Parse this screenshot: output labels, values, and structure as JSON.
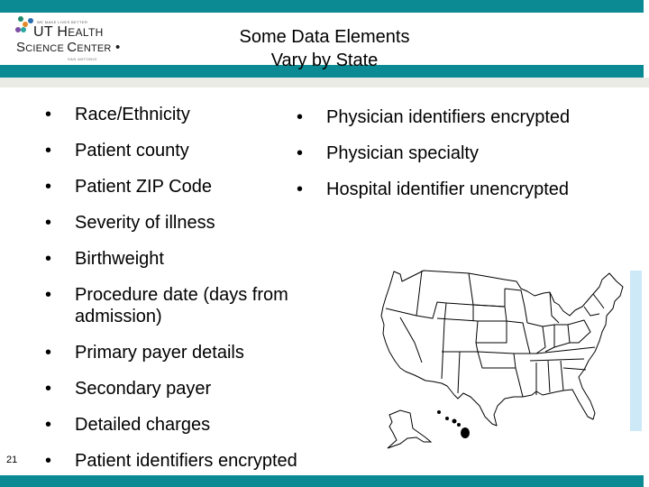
{
  "slide": {
    "title_line1": "Some Data Elements",
    "title_line2": "Vary by State",
    "slide_number": "21"
  },
  "logo": {
    "tagline": "WE MAKE LIVES BETTER",
    "line1_U": "UT H",
    "line1_rest": "EALTH",
    "line2_S": "S",
    "line2_rest1": "CIENCE ",
    "line2_C": "C",
    "line2_rest2": "ENTER",
    "line2_dot": " •",
    "sub": "SAN ANTONIO",
    "dot_colors": [
      "#1f8a6e",
      "#e38b2c",
      "#2a6fb0",
      "#7b4ea3",
      "#2aa7a0"
    ]
  },
  "colors": {
    "band": "#0b8a94",
    "gray_strip": "#ebebe6",
    "side_strip": "#cde9f8"
  },
  "left_bullets": [
    {
      "bullet": "•",
      "text": "Race/Ethnicity"
    },
    {
      "bullet": "•",
      "text": "Patient county"
    },
    {
      "bullet": "•",
      "text": "Patient ZIP Code"
    },
    {
      "bullet": "•",
      "text": "Severity of illness"
    },
    {
      "bullet": "•",
      "text": "Birthweight"
    },
    {
      "bullet": "•",
      "text": "Procedure date (days from admission)"
    },
    {
      "bullet": "•",
      "text": "Primary payer details"
    },
    {
      "bullet": "•",
      "text": "Secondary payer"
    },
    {
      "bullet": "•",
      "text": "Detailed charges"
    },
    {
      "bullet": "•",
      "text": "Patient identifiers encrypted"
    }
  ],
  "right_bullets": [
    {
      "bullet": "•",
      "text": "Physician identifiers encrypted"
    },
    {
      "bullet": "•",
      "text": "Physician specialty"
    },
    {
      "bullet": "•",
      "text": "Hospital identifier unencrypted"
    }
  ],
  "map": {
    "subject": "United States outline map with state borders, Alaska and Hawaii inset"
  }
}
